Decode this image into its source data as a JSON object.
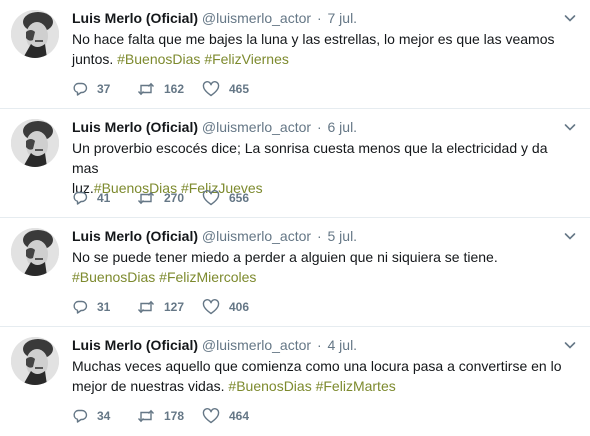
{
  "tweets": [
    {
      "name": "Luis Merlo (Oficial)",
      "handle": "@luismerlo_actor",
      "separator": "·",
      "time": "7 jul.",
      "line1": "No hace falta que me bajes la luna y las estrellas, lo mejor es que las veamos",
      "line2_pre": "juntos.",
      "line2_sep": " ",
      "hashtag1": "#BuenosDias",
      "hashtag2": "#FelizViernes",
      "replies": "37",
      "retweets": "162",
      "likes": "465"
    },
    {
      "name": "Luis Merlo (Oficial)",
      "handle": "@luismerlo_actor",
      "separator": "·",
      "time": "6 jul.",
      "line1": "Un proverbio escocés dice; La sonrisa cuesta menos que la electricidad y da mas",
      "line2_pre": "luz.",
      "line2_sep": "",
      "hashtag1": "#BuenosDias",
      "hashtag2": "#FelizJueves",
      "replies": "41",
      "retweets": "270",
      "likes": "656"
    },
    {
      "name": "Luis Merlo (Oficial)",
      "handle": "@luismerlo_actor",
      "separator": "·",
      "time": "5 jul.",
      "line1": "No se puede tener miedo a perder a alguien que ni siquiera se tiene.",
      "line2_pre": "",
      "line2_sep": "",
      "hashtag1": "#BuenosDias",
      "hashtag2": "#FelizMiercoles",
      "replies": "31",
      "retweets": "127",
      "likes": "406"
    },
    {
      "name": "Luis Merlo (Oficial)",
      "handle": "@luismerlo_actor",
      "separator": "·",
      "time": "4 jul.",
      "line1": "Muchas veces aquello que comienza como una locura pasa a convertirse en lo",
      "line2_pre": "mejor de nuestras vidas.",
      "line2_sep": " ",
      "hashtag1": "#BuenosDias",
      "hashtag2": "#FelizMartes",
      "replies": "34",
      "retweets": "178",
      "likes": "464"
    }
  ],
  "icons": {
    "reply": "reply-icon",
    "retweet": "retweet-icon",
    "like": "heart-icon",
    "menu": "chevron-down-icon"
  },
  "colors": {
    "hashtag": "#7d8a2e",
    "meta": "#657786",
    "text": "#14171a",
    "divider": "#e6ecf0"
  }
}
